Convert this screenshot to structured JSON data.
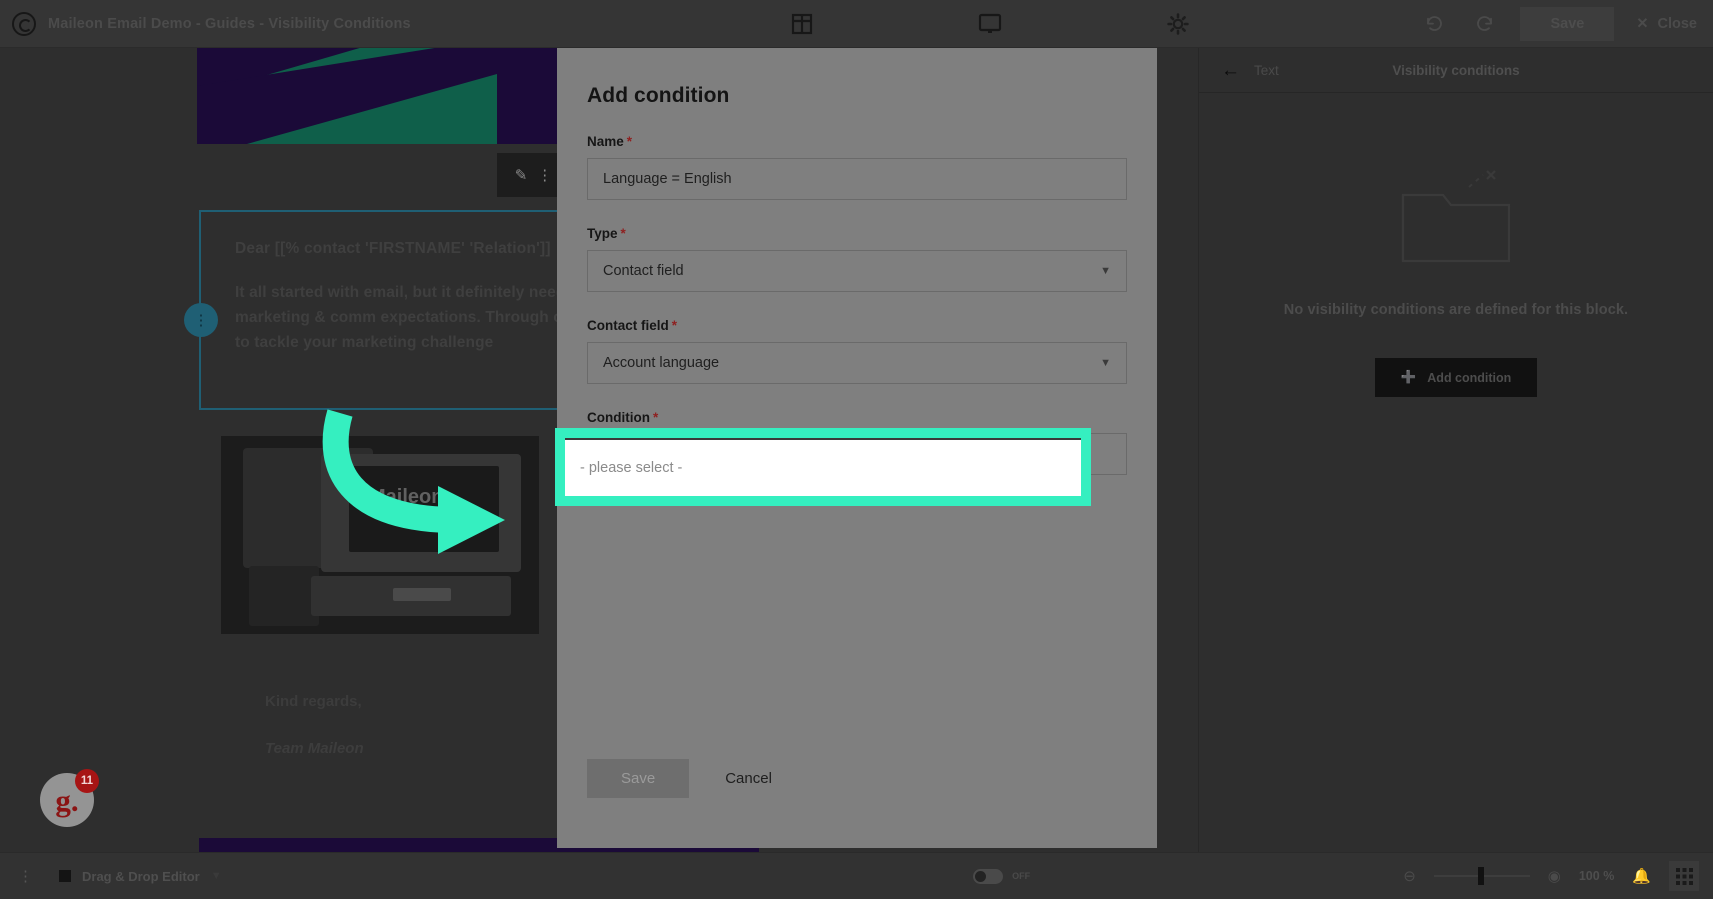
{
  "topbar": {
    "logo_icon": "maileon-logo-icon",
    "title": "Maileon Email Demo - Guides - Visibility Conditions",
    "icons": [
      {
        "name": "layout-grid-icon",
        "label": "Layout"
      },
      {
        "name": "desktop-preview-icon",
        "label": "Preview"
      },
      {
        "name": "gear-icon",
        "label": "Settings"
      }
    ],
    "undo_icon": "undo-icon",
    "redo_icon": "redo-icon",
    "save_label": "Save",
    "close_label": "Close",
    "close_icon": "close-x-icon"
  },
  "canvas": {
    "edit_chip": {
      "pencil_icon": "pencil-icon",
      "dots_icon": "drag-dots-icon"
    },
    "email": {
      "salutation": "Dear [[% contact 'FIRSTNAME' 'Relation']]",
      "paragraph": "It all started with email, but it definitely need to create great marketing & comm expectations. Through our powerful inte need to tackle your marketing challenge",
      "regards": "Kind regards,",
      "signature": "Team Maileon",
      "image_brandword": "Maileon"
    },
    "annotation_arrow": {
      "name": "green-pointer-arrow",
      "color": "#35efc0"
    }
  },
  "modal": {
    "title": "Add condition",
    "fields": [
      {
        "label": "Name",
        "required": true,
        "value": "Language = English",
        "control": "text"
      },
      {
        "label": "Type",
        "required": true,
        "value": "Contact field",
        "control": "select"
      },
      {
        "label": "Contact field",
        "required": true,
        "value": "Account language",
        "control": "select"
      },
      {
        "label": "Condition",
        "required": true,
        "value": "- please select -",
        "control": "select"
      }
    ],
    "required_marker": "*",
    "chevron_icon": "chevron-down-icon",
    "save_label": "Save",
    "cancel_label": "Cancel",
    "highlight_color": "#35efc0"
  },
  "right_panel": {
    "back_label": "Text",
    "back_icon": "arrow-left-icon",
    "title": "Visibility conditions",
    "empty_icon": "empty-folder-icon",
    "empty_message": "No visibility conditions are defined for this block.",
    "add_button_label": "Add condition",
    "add_button_icon": "plus-icon"
  },
  "bottombar": {
    "kebab_icon": "kebab-menu-icon",
    "editor_label": "Drag & Drop Editor",
    "editor_chevron_icon": "chevron-down-icon",
    "toggle_label": "OFF",
    "zoom_out_icon": "zoom-out-icon",
    "zoom_reset_icon": "zoom-reset-icon",
    "zoom_value": "100 %",
    "bell_icon": "bell-icon",
    "grid_icon": "grid-apps-icon"
  },
  "floating_badge": {
    "mark": "g.",
    "count": "11",
    "name": "guides-widget"
  }
}
